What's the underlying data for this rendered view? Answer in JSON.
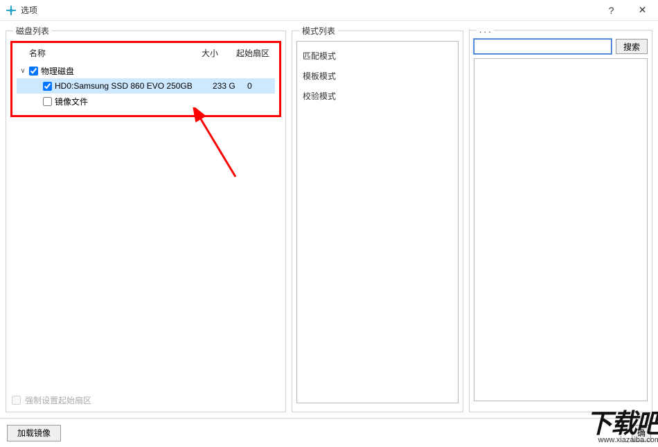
{
  "window": {
    "title": "选项",
    "help_hint": "?",
    "close_hint": "✕"
  },
  "disk_panel": {
    "legend": "磁盘列表",
    "columns": {
      "name": "名称",
      "size": "大小",
      "sector": "起始扇区"
    },
    "tree": {
      "physical_label": "物理磁盘",
      "physical_checked": true,
      "child": {
        "label": "HD0:Samsung SSD 860 EVO 250GB",
        "size": "233 G",
        "sector": "0",
        "checked": true
      },
      "image_label": "镜像文件",
      "image_checked": false
    },
    "force_label": "强制设置起始扇区"
  },
  "mode_panel": {
    "legend": "模式列表",
    "items": [
      "匹配模式",
      "模板模式",
      "校验模式"
    ]
  },
  "right_panel": {
    "legend": ". . .",
    "search_btn": "搜索",
    "search_value": ""
  },
  "bottom": {
    "load_image": "加载镜像",
    "ok_partial": "确"
  },
  "watermark": {
    "big": "下载吧",
    "url": "www.xiazaiba.com"
  }
}
